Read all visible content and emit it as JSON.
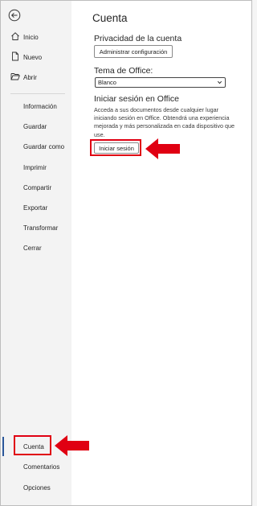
{
  "nav": {
    "back_icon": "arrow-left-circle-icon",
    "top_items": [
      {
        "icon": "home-icon",
        "label": "Inicio"
      },
      {
        "icon": "new-document-icon",
        "label": "Nuevo"
      },
      {
        "icon": "folder-open-icon",
        "label": "Abrir"
      }
    ],
    "mid_items": [
      "Información",
      "Guardar",
      "Guardar como",
      "Imprimir",
      "Compartir",
      "Exportar",
      "Transformar",
      "Cerrar"
    ],
    "bottom_items": [
      "Cuenta",
      "Comentarios",
      "Opciones"
    ]
  },
  "main": {
    "title": "Cuenta",
    "privacy": {
      "title": "Privacidad de la cuenta",
      "button": "Administrar configuración"
    },
    "theme": {
      "title": "Tema de Office:",
      "value": "Blanco"
    },
    "signin": {
      "title": "Iniciar sesión en Office",
      "description": "Acceda a sus documentos desde cualquier lugar iniciando sesión en Office. Obtendrá una experiencia mejorada y más personalizada en cada dispositivo que use.",
      "button": "Iniciar sesión"
    }
  },
  "colors": {
    "annotation_red": "#e00012",
    "active_accent": "#2b579a"
  }
}
